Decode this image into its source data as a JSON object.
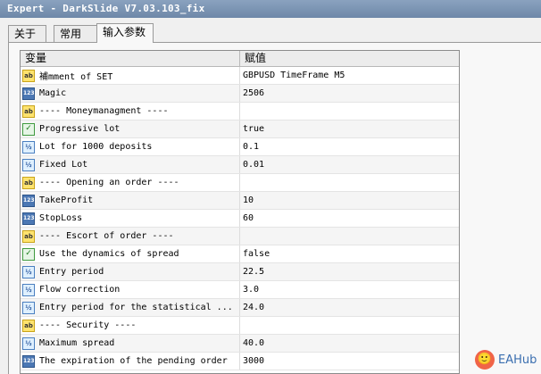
{
  "window": {
    "title": "Expert - DarkSlide V7.03.103_fix"
  },
  "tabs": [
    {
      "label": "关于",
      "active": false
    },
    {
      "label": "常用",
      "active": false
    },
    {
      "label": "输入参数",
      "active": true
    }
  ],
  "grid": {
    "col_variable": "变量",
    "col_value": "赋值",
    "rows": [
      {
        "icon": "ab",
        "name": "補mment of SET",
        "value": "GBPUSD  TimeFrame M5"
      },
      {
        "icon": "123",
        "name": "Magic",
        "value": "2506"
      },
      {
        "icon": "ab",
        "name": "----   Moneymanagment   ----",
        "value": ""
      },
      {
        "icon": "bool",
        "name": "Progressive lot",
        "value": "true"
      },
      {
        "icon": "dbl",
        "name": "Lot for 1000 deposits",
        "value": "0.1"
      },
      {
        "icon": "dbl",
        "name": "Fixed Lot",
        "value": "0.01"
      },
      {
        "icon": "ab",
        "name": "----   Opening an order  ----",
        "value": ""
      },
      {
        "icon": "123",
        "name": "TakeProfit",
        "value": "10"
      },
      {
        "icon": "123",
        "name": "StopLoss",
        "value": "60"
      },
      {
        "icon": "ab",
        "name": "----   Escort of order   ----",
        "value": ""
      },
      {
        "icon": "bool",
        "name": "Use the dynamics of spread",
        "value": "false"
      },
      {
        "icon": "dbl",
        "name": "Entry period",
        "value": "22.5"
      },
      {
        "icon": "dbl",
        "name": "Flow correction",
        "value": "3.0"
      },
      {
        "icon": "dbl",
        "name": "Entry period for the statistical ...",
        "value": "24.0"
      },
      {
        "icon": "ab",
        "name": "----  Security        ----",
        "value": ""
      },
      {
        "icon": "dbl",
        "name": "Maximum spread",
        "value": "40.0"
      },
      {
        "icon": "123",
        "name": "The expiration of the pending order",
        "value": "3000"
      }
    ]
  },
  "icons": {
    "ab": {
      "glyph": "ab",
      "semantic": "string-type-icon"
    },
    "123": {
      "glyph": "123",
      "semantic": "integer-type-icon"
    },
    "bool": {
      "glyph": "✓",
      "semantic": "boolean-type-icon"
    },
    "dbl": {
      "glyph": "½",
      "semantic": "double-type-icon"
    }
  },
  "watermark": {
    "logo_glyph": "🙂",
    "text": "EAHub"
  }
}
